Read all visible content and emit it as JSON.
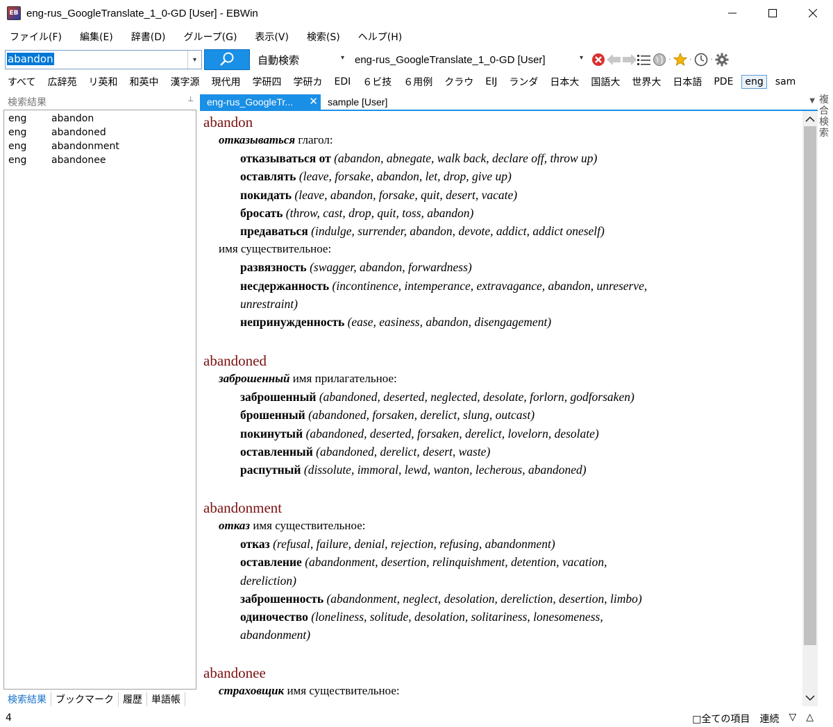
{
  "window": {
    "title": "eng-rus_GoogleTranslate_1_0-GD [User] - EBWin",
    "app_icon_text": "EB"
  },
  "menu": [
    "ファイル(F)",
    "編集(E)",
    "辞書(D)",
    "グループ(G)",
    "表示(V)",
    "検索(S)",
    "ヘルプ(H)"
  ],
  "toolbar": {
    "search_value": "abandon",
    "search_mode": "自動検索",
    "dictionary": "eng-rus_GoogleTranslate_1_0-GD [User]"
  },
  "dict_tabs": [
    "すべて",
    "広辞苑",
    "リ英和",
    "和英中",
    "漢字源",
    "現代用",
    "学研四",
    "学研カ",
    "EDI",
    "６ビ技",
    "６用例",
    "クラウ",
    "EIJ",
    "ランダ",
    "日本大",
    "国語大",
    "世界大",
    "日本語",
    "PDE",
    "eng",
    "sam"
  ],
  "active_dict_tab": "eng",
  "left_pane": {
    "title": "検索結果",
    "results": [
      {
        "dict": "eng",
        "word": "abandon"
      },
      {
        "dict": "eng",
        "word": "abandoned"
      },
      {
        "dict": "eng",
        "word": "abandonment"
      },
      {
        "dict": "eng",
        "word": "abandonee"
      }
    ],
    "bottom_tabs": [
      "検索結果",
      "ブックマーク",
      "履歴",
      "単語帳"
    ]
  },
  "content_tabs": [
    {
      "label": "eng-rus_GoogleTr..."
    },
    {
      "label": "sample [User]"
    }
  ],
  "side_tab": "複合検索",
  "entries": [
    {
      "headword": "abandon",
      "groups": [
        {
          "pos_word": "отказываться",
          "pos": "глагол:",
          "lines": [
            {
              "ru": "отказываться от",
              "syn": "(abandon, abnegate, walk back, declare off, throw up)"
            },
            {
              "ru": "оставлять",
              "syn": "(leave, forsake, abandon, let, drop, give up)"
            },
            {
              "ru": "покидать",
              "syn": "(leave, abandon, forsake, quit, desert, vacate)"
            },
            {
              "ru": "бросать",
              "syn": "(throw, cast, drop, quit, toss, abandon)"
            },
            {
              "ru": "предаваться",
              "syn": "(indulge, surrender, abandon, devote, addict, addict oneself)"
            }
          ]
        },
        {
          "pos_word": "",
          "pos": "имя существительное:",
          "lines": [
            {
              "ru": "развязность",
              "syn": "(swagger, abandon, forwardness)"
            },
            {
              "ru": "несдержанность",
              "syn": "(incontinence, intemperance, extravagance, abandon, unreserve,",
              "cont": "unrestraint)"
            },
            {
              "ru": "непринужденность",
              "syn": "(ease, easiness, abandon, disengagement)"
            }
          ]
        }
      ]
    },
    {
      "headword": "abandoned",
      "groups": [
        {
          "pos_word": "заброшенный",
          "pos": "имя прилагательное:",
          "lines": [
            {
              "ru": "заброшенный",
              "syn": "(abandoned, deserted, neglected, desolate, forlorn, godforsaken)"
            },
            {
              "ru": "брошенный",
              "syn": "(abandoned, forsaken, derelict, slung, outcast)"
            },
            {
              "ru": "покинутый",
              "syn": "(abandoned, deserted, forsaken, derelict, lovelorn, desolate)"
            },
            {
              "ru": "оставленный",
              "syn": "(abandoned, derelict, desert, waste)"
            },
            {
              "ru": "распутный",
              "syn": "(dissolute, immoral, lewd, wanton, lecherous, abandoned)"
            }
          ]
        }
      ]
    },
    {
      "headword": "abandonment",
      "groups": [
        {
          "pos_word": "отказ",
          "pos": "имя существительное:",
          "lines": [
            {
              "ru": "отказ",
              "syn": "(refusal, failure, denial, rejection, refusing, abandonment)"
            },
            {
              "ru": "оставление",
              "syn": "(abandonment, desertion, relinquishment, detention, vacation,",
              "cont": "dereliction)"
            },
            {
              "ru": "заброшенность",
              "syn": "(abandonment, neglect, desolation, dereliction, desertion, limbo)"
            },
            {
              "ru": "одиночество",
              "syn": "(loneliness, solitude, desolation, solitariness, lonesomeness,",
              "cont": "abandonment)"
            }
          ]
        }
      ]
    },
    {
      "headword": "abandonee",
      "groups": [
        {
          "pos_word": "страховщик",
          "pos": "имя существительное:",
          "lines": []
        }
      ]
    }
  ],
  "status": {
    "count": "4",
    "all_items": "□全ての項目",
    "continuous": "連続",
    "nav_down": "▽",
    "nav_up": "△"
  }
}
